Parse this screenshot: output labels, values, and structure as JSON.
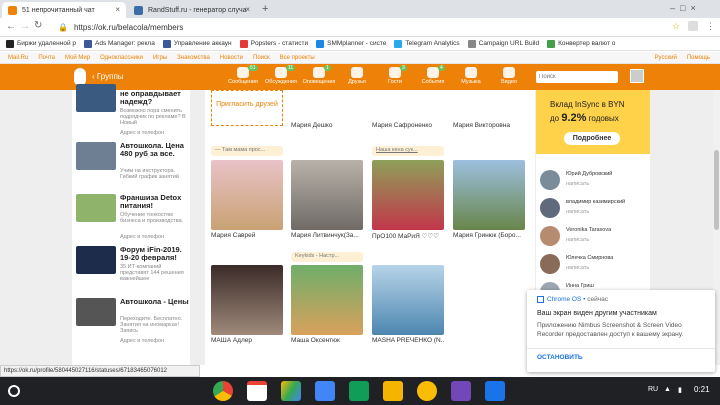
{
  "tabs": [
    {
      "title": "51 непрочитанный чат"
    },
    {
      "title": "RandStuff.ru - генератор случа"
    }
  ],
  "omnibox": {
    "url": "https://ok.ru/belacola/members"
  },
  "bookmarks": [
    "Биржи удаленной р",
    "Ads Manager: рекла",
    "Управление аккаун",
    "Popsters - статисти",
    "SMMplanner - систе",
    "Telegram Analytics",
    "Campaign URL Build",
    "Конвертер валют о"
  ],
  "oktop": [
    "Mail.Ru",
    "Почта",
    "Мой Мир",
    "Одноклассники",
    "Игры",
    "Знакомства",
    "Новости",
    "Поиск",
    "Все проекты"
  ],
  "okbar": {
    "back": "‹ Группы",
    "search_placeholder": "Поиск",
    "lang": "Русский",
    "help": "Помощь",
    "items": [
      {
        "label": "Сообщения",
        "badge": "51"
      },
      {
        "label": "Обсуждения",
        "badge": "11"
      },
      {
        "label": "Оповещения",
        "badge": "1"
      },
      {
        "label": "Друзья",
        "badge": ""
      },
      {
        "label": "Гости",
        "badge": "3"
      },
      {
        "label": "События",
        "badge": "4"
      },
      {
        "label": "Музыка",
        "badge": ""
      },
      {
        "label": "Видео",
        "badge": ""
      }
    ]
  },
  "left_ads": [
    {
      "title": "не оправдывает надежд?",
      "desc": "Возможно пора сменить подрядчик по рекламе? В Новый",
      "src": "pixel.ru",
      "link": "Адрес и телефон"
    },
    {
      "title": "Автошкола. Цена 480 руб за все.",
      "desc": "Учим на инструктора. Гибкий график занятий",
      "src": "",
      "link": ""
    },
    {
      "title": "Франшиза Detox питания!",
      "desc": "Обучение тонкостям бизнеса и производства.",
      "src": "franchise.ru",
      "link": "Адрес и телефон"
    },
    {
      "title": "Форум iFin-2019. 19-20 февраля!",
      "desc": "35 ИТ-компаний представят 144 решения важнейшее",
      "src": "",
      "link": ""
    },
    {
      "title": "Автошкола - Цены",
      "desc": "Переходите. Бесплатно. Занятия на иномарках! Запись",
      "src": "",
      "link": "Адрес и телефон"
    }
  ],
  "invite": "Пригласить друзей",
  "row1_names": [
    "Мария Дешко",
    "Мария Сафроненко",
    "Мария Викторовна"
  ],
  "row2_pills": [
    "— Там мама прос...",
    "Наша кена сук..."
  ],
  "row2_names": [
    "Мария Саврей",
    "Мария Литвинчук(За...",
    "ПрО100 МаРиЯ ♡♡♡",
    "Мария Гринюк (Боро..."
  ],
  "row3_pill": "Keykids - Настр...",
  "row3_names": [
    "МАША Адлер",
    "Маша Оксентюк",
    "MASHA PREЧЕНКО (N..."
  ],
  "banner": {
    "line1": "Вклад InSync в BYN",
    "line2": "до",
    "rate": "9.2%",
    "line3": "годовых",
    "button": "Подробнее"
  },
  "friends": [
    {
      "name": "Юрий Дубровский",
      "action": "написать"
    },
    {
      "name": "владимир казимирский",
      "action": "написать"
    },
    {
      "name": "Veronika Tarasova",
      "action": "написать"
    },
    {
      "name": "Юлечка Смирнова",
      "action": "написать"
    },
    {
      "name": "Инна Гриш",
      "action": ""
    }
  ],
  "status_url": "https://ok.ru/profile/580445027116/statuses/67183465076012",
  "notification": {
    "app": "Chrome OS",
    "time": "сейчас",
    "title": "Ваш экран виден другим участникам",
    "body": "Приложению Nimbus Screenshot & Screen Video Recorder предоставлен доступ к вашему экрану.",
    "button": "ОСТАНОВИТЬ"
  },
  "tray": {
    "lang": "RU",
    "time": "0:21"
  }
}
